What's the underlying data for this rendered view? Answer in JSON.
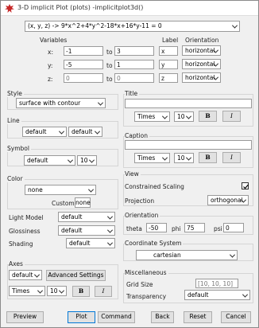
{
  "window": {
    "title": "3-D implicit Plot (plots) -implicitplot3d()"
  },
  "expression": {
    "value": "(x, y, z) -> 9*x^2+4*y^2-18*x+16*y-11 = 0"
  },
  "ranges": {
    "headers": {
      "variables": "Variables",
      "label": "Label",
      "orientation": "Orientation"
    },
    "rows": [
      {
        "var": "x:",
        "from": "-1",
        "to_label": "to",
        "to": "3",
        "label": "x",
        "orientation": "horizontal"
      },
      {
        "var": "y:",
        "from": "-5",
        "to_label": "to",
        "to": "1",
        "label": "y",
        "orientation": "horizontal"
      },
      {
        "var": "z:",
        "from": "0",
        "to_label": "to",
        "to": "0",
        "label": "z",
        "orientation": "horizontal"
      }
    ]
  },
  "left": {
    "style_label": "Style",
    "style_value": "surface with contour",
    "line_label": "Line",
    "line_value1": "default",
    "line_value2": "default",
    "symbol_label": "Symbol",
    "symbol_value": "default",
    "symbol_size": "10",
    "color_label": "Color",
    "color_value": "none",
    "custom_label": "Custom",
    "none_btn": "none",
    "light_label": "Light Model",
    "light_value": "default",
    "gloss_label": "Glossiness",
    "gloss_value": "default",
    "shading_label": "Shading",
    "shading_value": "default",
    "axes_label": "Axes",
    "axes_value": "default",
    "advanced_btn": "Advanced Settings",
    "font_value": "Times",
    "font_size": "10",
    "bold": "B",
    "italic": "I"
  },
  "right": {
    "title_label": "Title",
    "title_value": "",
    "title_font": "Times",
    "title_size": "10",
    "caption_label": "Caption",
    "caption_value": "",
    "caption_font": "Times",
    "caption_size": "10",
    "bold": "B",
    "italic": "I",
    "view_label": "View",
    "constrained_label": "Constrained Scaling",
    "constrained_checked": true,
    "projection_label": "Projection",
    "projection_value": "orthogonal",
    "orientation_label": "Orientation",
    "theta_label": "theta",
    "theta_value": "-50",
    "phi_label": "phi",
    "phi_value": "75",
    "psi_label": "psi",
    "psi_value": "0",
    "coord_label": "Coordinate System",
    "coord_value": "cartesian",
    "misc_label": "Miscellaneous",
    "grid_label": "Grid Size",
    "grid_value": "[10, 10, 10]",
    "transp_label": "Transparency",
    "transp_value": "default"
  },
  "footer": {
    "preview": "Preview",
    "plot": "Plot",
    "command": "Command",
    "back": "Back",
    "reset": "Reset",
    "cancel": "Cancel"
  }
}
